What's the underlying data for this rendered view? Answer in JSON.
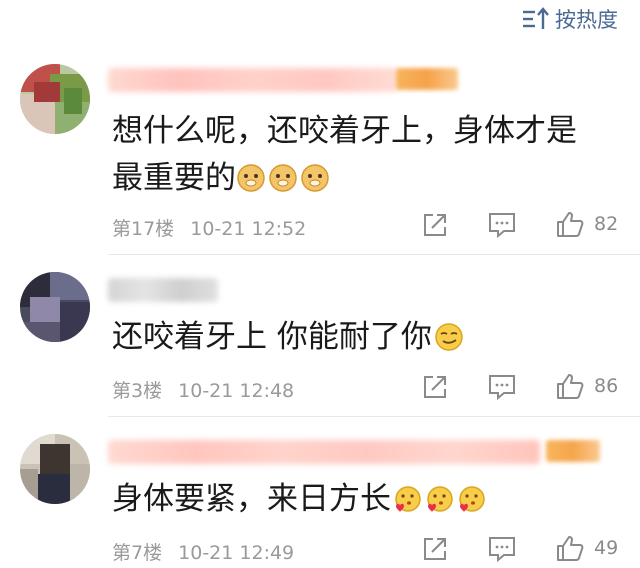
{
  "sort": {
    "label": "按热度",
    "icon": "sort-lines-arrow-icon"
  },
  "colors": {
    "link_blue": "#4a6a95",
    "meta_gray": "#9a9a9a",
    "divider": "#e8e8e8",
    "text": "#1a1a1a"
  },
  "comments": [
    {
      "text_line1": "想什么呢，还咬着牙上，身体才是",
      "text_line2": "最重要的",
      "emoji": "doge-emoji",
      "floor": "第17楼",
      "time": "10-21 12:52",
      "likes": "82"
    },
    {
      "text_line1": "还咬着牙上  你能耐了你",
      "emoji": "smirk-emoji",
      "floor": "第3楼",
      "time": "10-21 12:48",
      "likes": "86"
    },
    {
      "text_line1": "身体要紧，来日方长",
      "emoji": "heart-kiss-emoji",
      "floor": "第7楼",
      "time": "10-21 12:49",
      "likes": "49"
    }
  ]
}
